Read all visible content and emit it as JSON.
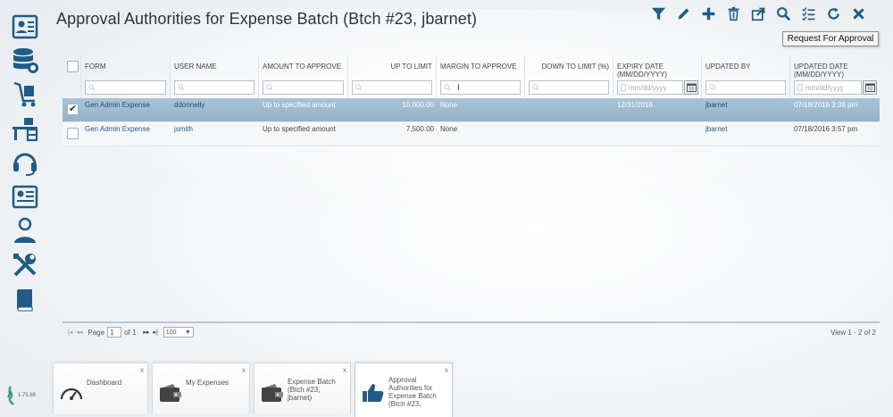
{
  "title": "Approval Authorities for Expense Batch (Btch #23, jbarnet)",
  "tooltip": "Request For Approval",
  "toolbar": [
    "filter-icon",
    "pencil-icon",
    "plus-icon",
    "trash-icon",
    "export-icon",
    "search-icon",
    "checklist-icon",
    "refresh-icon",
    "close-icon"
  ],
  "columns": [
    {
      "label": "FORM"
    },
    {
      "label": "USER NAME"
    },
    {
      "label": "AMOUNT TO APPROVE"
    },
    {
      "label": "UP TO LIMIT"
    },
    {
      "label": "MARGIN TO APPROVE"
    },
    {
      "label": "DOWN TO LIMIT (%)"
    },
    {
      "label": "EXPIRY DATE (MM/DD/YYYY)"
    },
    {
      "label": "UPDATED BY"
    },
    {
      "label": "UPDATED DATE (MM/DD/YYYY)"
    }
  ],
  "date_placeholder": "mm/dd/yyyy",
  "rows": [
    {
      "selected": true,
      "form": "Gen Admin Expense",
      "user": "ddonnelly",
      "amount": "Up to specified amount",
      "limit": "10,000.00",
      "margin": "None",
      "down": "",
      "expiry": "12/31/2016",
      "updated_by": "jbarnet",
      "updated_date": "07/18/2016 3:36 pm"
    },
    {
      "selected": false,
      "form": "Gen Admin Expense",
      "user": "jsmith",
      "amount": "Up to specified amount",
      "limit": "7,500.00",
      "margin": "None",
      "down": "",
      "expiry": "",
      "updated_by": "jbarnet",
      "updated_date": "07/18/2016 3:57 pm"
    }
  ],
  "pager": {
    "page_label": "Page",
    "page": "1",
    "of_label": "of 1",
    "page_size": "100",
    "view_info": "View 1 - 2 of 2"
  },
  "tabs": [
    {
      "label": "Dashboard",
      "icon": "gauge-icon"
    },
    {
      "label": "My Expenses",
      "icon": "wallet-icon"
    },
    {
      "label": "Expense Batch (Btch #23, jbarnet)",
      "icon": "wallet-icon"
    },
    {
      "label": "Approval Authorities for Expense Batch (Btch #23,",
      "icon": "thumbs-up-icon"
    }
  ],
  "version": "1.75.88",
  "sidebar": [
    "contact-card-icon",
    "database-icon",
    "cart-icon",
    "desk-icon",
    "headset-icon",
    "news-icon",
    "users-icon",
    "tools-icon",
    "book-icon"
  ]
}
